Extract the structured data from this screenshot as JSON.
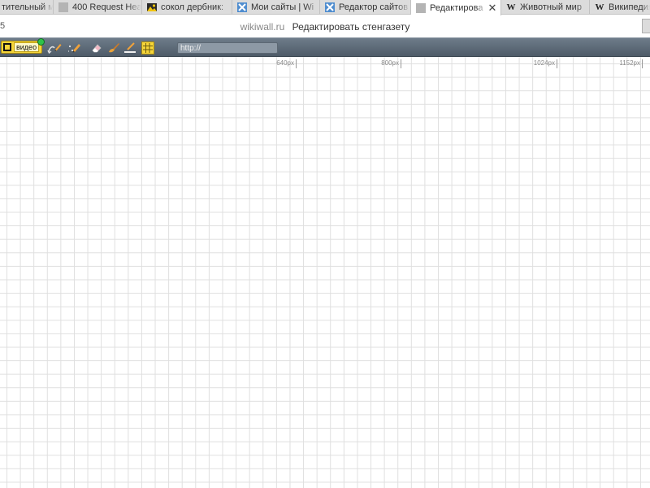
{
  "browser": {
    "tabs": [
      {
        "label": "тительный м",
        "favicon": "none",
        "active": false
      },
      {
        "label": "400 Request Hea",
        "favicon": "gray-page-icon",
        "active": false
      },
      {
        "label": "сокол дербник:",
        "favicon": "image-icon",
        "active": false
      },
      {
        "label": "Мои сайты | Wi",
        "favicon": "wikiwall-icon",
        "active": false
      },
      {
        "label": "Редактор сайтов",
        "favicon": "wikiwall-icon",
        "active": false
      },
      {
        "label": "Редактирова",
        "favicon": "gray-page-icon",
        "active": true,
        "close": "✕"
      },
      {
        "label": "Животный мир",
        "favicon": "wikipedia-icon",
        "active": false
      },
      {
        "label": "Википедия",
        "favicon": "wikipedia-icon",
        "active": false
      }
    ],
    "wikipedia_glyph": "W",
    "left_edge_fragment": "5",
    "domain": "wikiwall.ru",
    "page_title": "Редактировать стенгазету"
  },
  "toolbar": {
    "video_button_label": "видео",
    "url_value": "http://",
    "icons": [
      "arrow-pencil-icon",
      "sparkle-pencil-icon",
      "eraser-icon",
      "brush-icon",
      "line-icon",
      "grid-toggle-icon"
    ]
  },
  "canvas": {
    "width_markers": [
      "640px",
      "800px",
      "1024px",
      "1152px"
    ]
  },
  "colors": {
    "toolbar": "#5c6976",
    "accent_yellow": "#f6d63a",
    "grid_line": "#dfdfdf"
  }
}
